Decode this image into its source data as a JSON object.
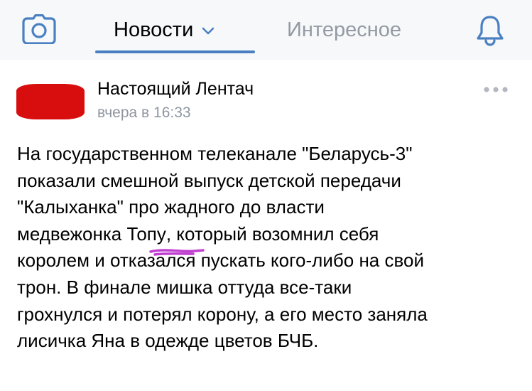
{
  "header": {
    "tabs": [
      {
        "label": "Новости",
        "active": true
      },
      {
        "label": "Интересное",
        "active": false
      }
    ],
    "icons": {
      "left": "camera-icon",
      "right": "bell-icon",
      "dropdown": "chevron-down-icon"
    },
    "accent_color": "#4a80c2"
  },
  "post": {
    "author": "Настоящий Лентач",
    "timestamp": "вчера в 16:33",
    "avatar_color": "#d80e0e",
    "menu_icon": "more-icon",
    "text_lines": [
      "На государственном телеканале \"Беларусь-3\"",
      "показали смешной выпуск детской передачи",
      "\"Калыханка\" про жадного до власти",
      "медвежонка ",
      "Топу",
      ", который возомнил себя",
      "королем и отказался пускать кого-либо на свой",
      "трон. В финале мишка оттуда все-таки",
      "грохнулся и потерял корону, а его место заняла",
      "лисичка Яна в одежде цветов БЧБ."
    ],
    "annotation_color": "#c03fd0"
  }
}
